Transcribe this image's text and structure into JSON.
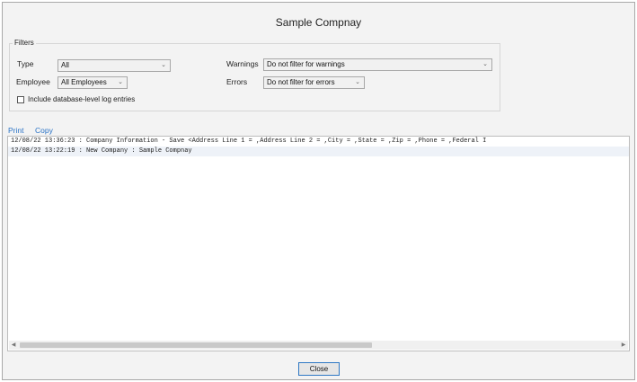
{
  "window": {
    "title": "Sample Compnay"
  },
  "filters": {
    "legend": "Filters",
    "type": {
      "label": "Type",
      "value": "All"
    },
    "employee": {
      "label": "Employee",
      "value": "All Employees"
    },
    "warnings": {
      "label": "Warnings",
      "value": "Do not filter for warnings"
    },
    "errors": {
      "label": "Errors",
      "value": "Do not filter for errors"
    },
    "include_db_label": "Include database-level log entries",
    "include_db_checked": false
  },
  "actions": {
    "print": "Print",
    "copy": "Copy"
  },
  "log": {
    "lines": [
      "12/08/22 13:36:23 : Company Information - Save <Address Line 1 = ,Address Line 2 = ,City = ,State = ,Zip = ,Phone = ,Federal I",
      "12/08/22 13:22:19 : New Company : Sample Compnay"
    ]
  },
  "footer": {
    "close_label": "Close"
  }
}
